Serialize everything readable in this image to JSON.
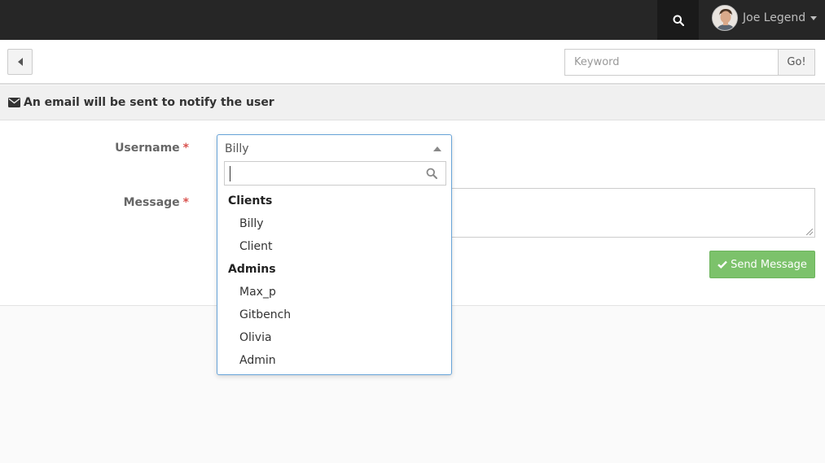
{
  "topbar": {
    "user_name": "Joe Legend",
    "icons": {
      "search": "search-icon",
      "avatar": "avatar",
      "dropdown": "caret-down-icon"
    }
  },
  "toolbar": {
    "back_icon": "caret-left-icon",
    "keyword_placeholder": "Keyword",
    "go_label": "Go!"
  },
  "panel": {
    "heading": "An email will be sent to notify the user",
    "heading_icon": "envelope-icon"
  },
  "form": {
    "username_label": "Username",
    "message_label": "Message",
    "required_mark": "*",
    "username_value": "Billy",
    "send_label": "Send Message",
    "send_icon": "check-icon"
  },
  "dropdown": {
    "search_value": "",
    "search_icon": "search-icon",
    "groups": [
      {
        "label": "Clients",
        "options": [
          "Billy",
          "Client"
        ]
      },
      {
        "label": "Admins",
        "options": [
          "Max_p",
          "Gitbench",
          "Olivia",
          "Admin"
        ]
      }
    ]
  },
  "colors": {
    "topbar_bg": "#262626",
    "send_button": "#7cc26b",
    "select_focus_border": "#66a3d8",
    "required": "#d9534f"
  }
}
